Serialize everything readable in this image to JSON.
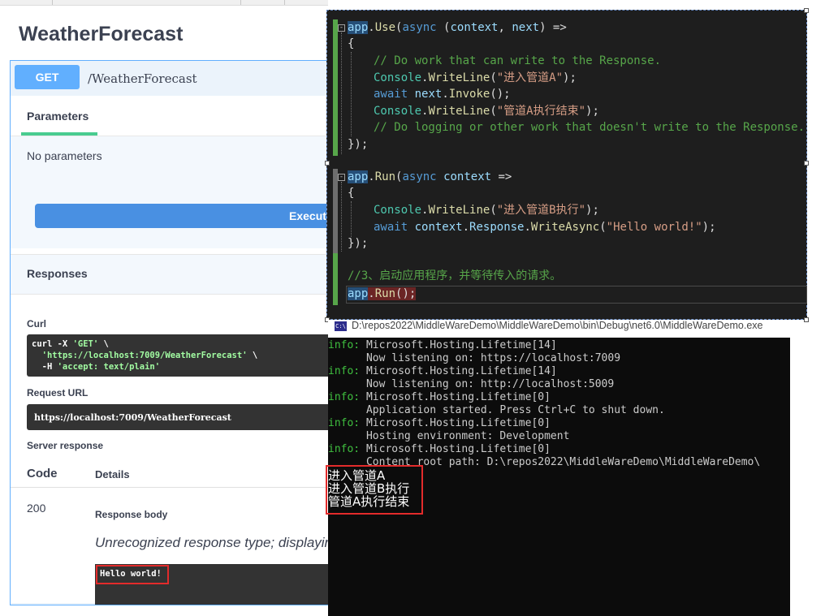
{
  "swagger": {
    "title": "WeatherForecast",
    "method": "GET",
    "path": "/WeatherForecast",
    "parameters_tab": "Parameters",
    "no_parameters": "No parameters",
    "execute_label": "Execute",
    "responses_title": "Responses",
    "curl_label": "Curl",
    "curl_lines": [
      "curl -X 'GET' \\",
      "  'https://localhost:7009/WeatherForecast' \\",
      "  -H 'accept: text/plain'"
    ],
    "request_url_label": "Request URL",
    "request_url": "https://localhost:7009/WeatherForecast",
    "server_response_label": "Server response",
    "code_header": "Code",
    "details_header": "Details",
    "status_code": "200",
    "response_body_label": "Response body",
    "unrecognized": "Unrecognized response type; displaying content as text.",
    "body_text": "Hello world!",
    "colors": {
      "get": "#61affe",
      "execute": "#4990e2",
      "highlight": "#e32b2b"
    }
  },
  "editor": {
    "comment_work": "// Do work that can write to the Response.",
    "writeline_a": "\"进入管道A\"",
    "writeline_a_end": "\"管道A执行结束\"",
    "comment_logging": "// Do logging or other work that doesn't write to the Response.",
    "writeline_b": "\"进入管道B执行\"",
    "hello": "\"Hello world!\"",
    "comment_step3": "//3、启动应用程序，并等待传入的请求。"
  },
  "console": {
    "title": "D:\\repos2022\\MiddleWareDemo\\MiddleWareDemo\\bin\\Debug\\net6.0\\MiddleWareDemo.exe",
    "lines": [
      {
        "level": "info:",
        "text": " Microsoft.Hosting.Lifetime[14]"
      },
      {
        "level": "",
        "text": "      Now listening on: https://localhost:7009"
      },
      {
        "level": "info:",
        "text": " Microsoft.Hosting.Lifetime[14]"
      },
      {
        "level": "",
        "text": "      Now listening on: http://localhost:5009"
      },
      {
        "level": "info:",
        "text": " Microsoft.Hosting.Lifetime[0]"
      },
      {
        "level": "",
        "text": "      Application started. Press Ctrl+C to shut down."
      },
      {
        "level": "info:",
        "text": " Microsoft.Hosting.Lifetime[0]"
      },
      {
        "level": "",
        "text": "      Hosting environment: Development"
      },
      {
        "level": "info:",
        "text": " Microsoft.Hosting.Lifetime[0]"
      },
      {
        "level": "",
        "text": "      Content root path: D:\\repos2022\\MiddleWareDemo\\MiddleWareDemo\\"
      }
    ],
    "output_lines": [
      "进入管道A",
      "进入管道B执行",
      "管道A执行结束"
    ]
  }
}
